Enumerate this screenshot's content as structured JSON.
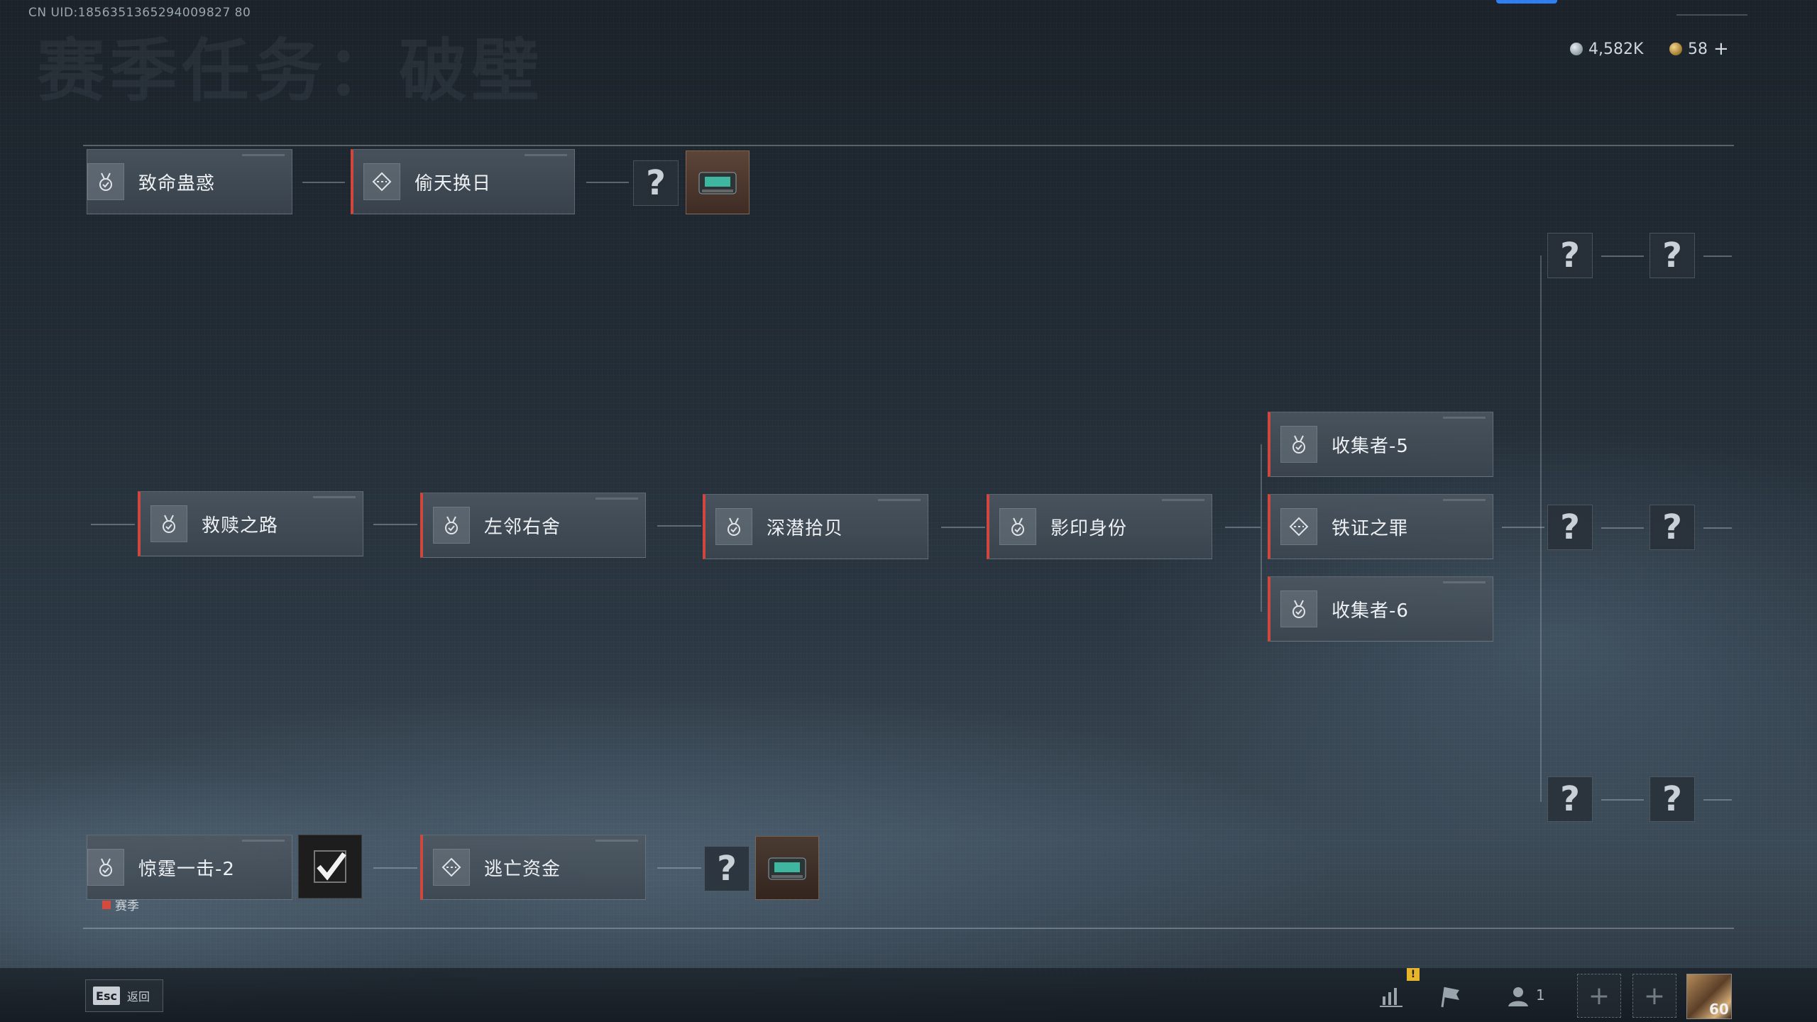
{
  "header": {
    "uid": "CN UID:1856351365294009827 80",
    "title": "赛季任务：破壁",
    "currency_1": "4,582K",
    "currency_2": "58",
    "add_label": "+"
  },
  "row1": {
    "node_1": "致命蛊惑",
    "node_2": "偷天换日",
    "unknown": "?"
  },
  "row2": {
    "node_1": "救赎之路",
    "node_2": "左邻右舍",
    "node_3": "深潜拾贝",
    "node_4": "影印身份",
    "branch_1": "收集者-5",
    "branch_2": "铁证之罪",
    "branch_3": "收集者-6",
    "unknown": "?"
  },
  "row3": {
    "node_1": "惊霆一击-2",
    "node_2": "逃亡资金",
    "season_tag": "赛季",
    "unknown": "?"
  },
  "footer": {
    "esc_key": "Esc",
    "esc_label": "返回",
    "warning": "!",
    "players": "1",
    "slot_plus": "+",
    "level": "60"
  }
}
